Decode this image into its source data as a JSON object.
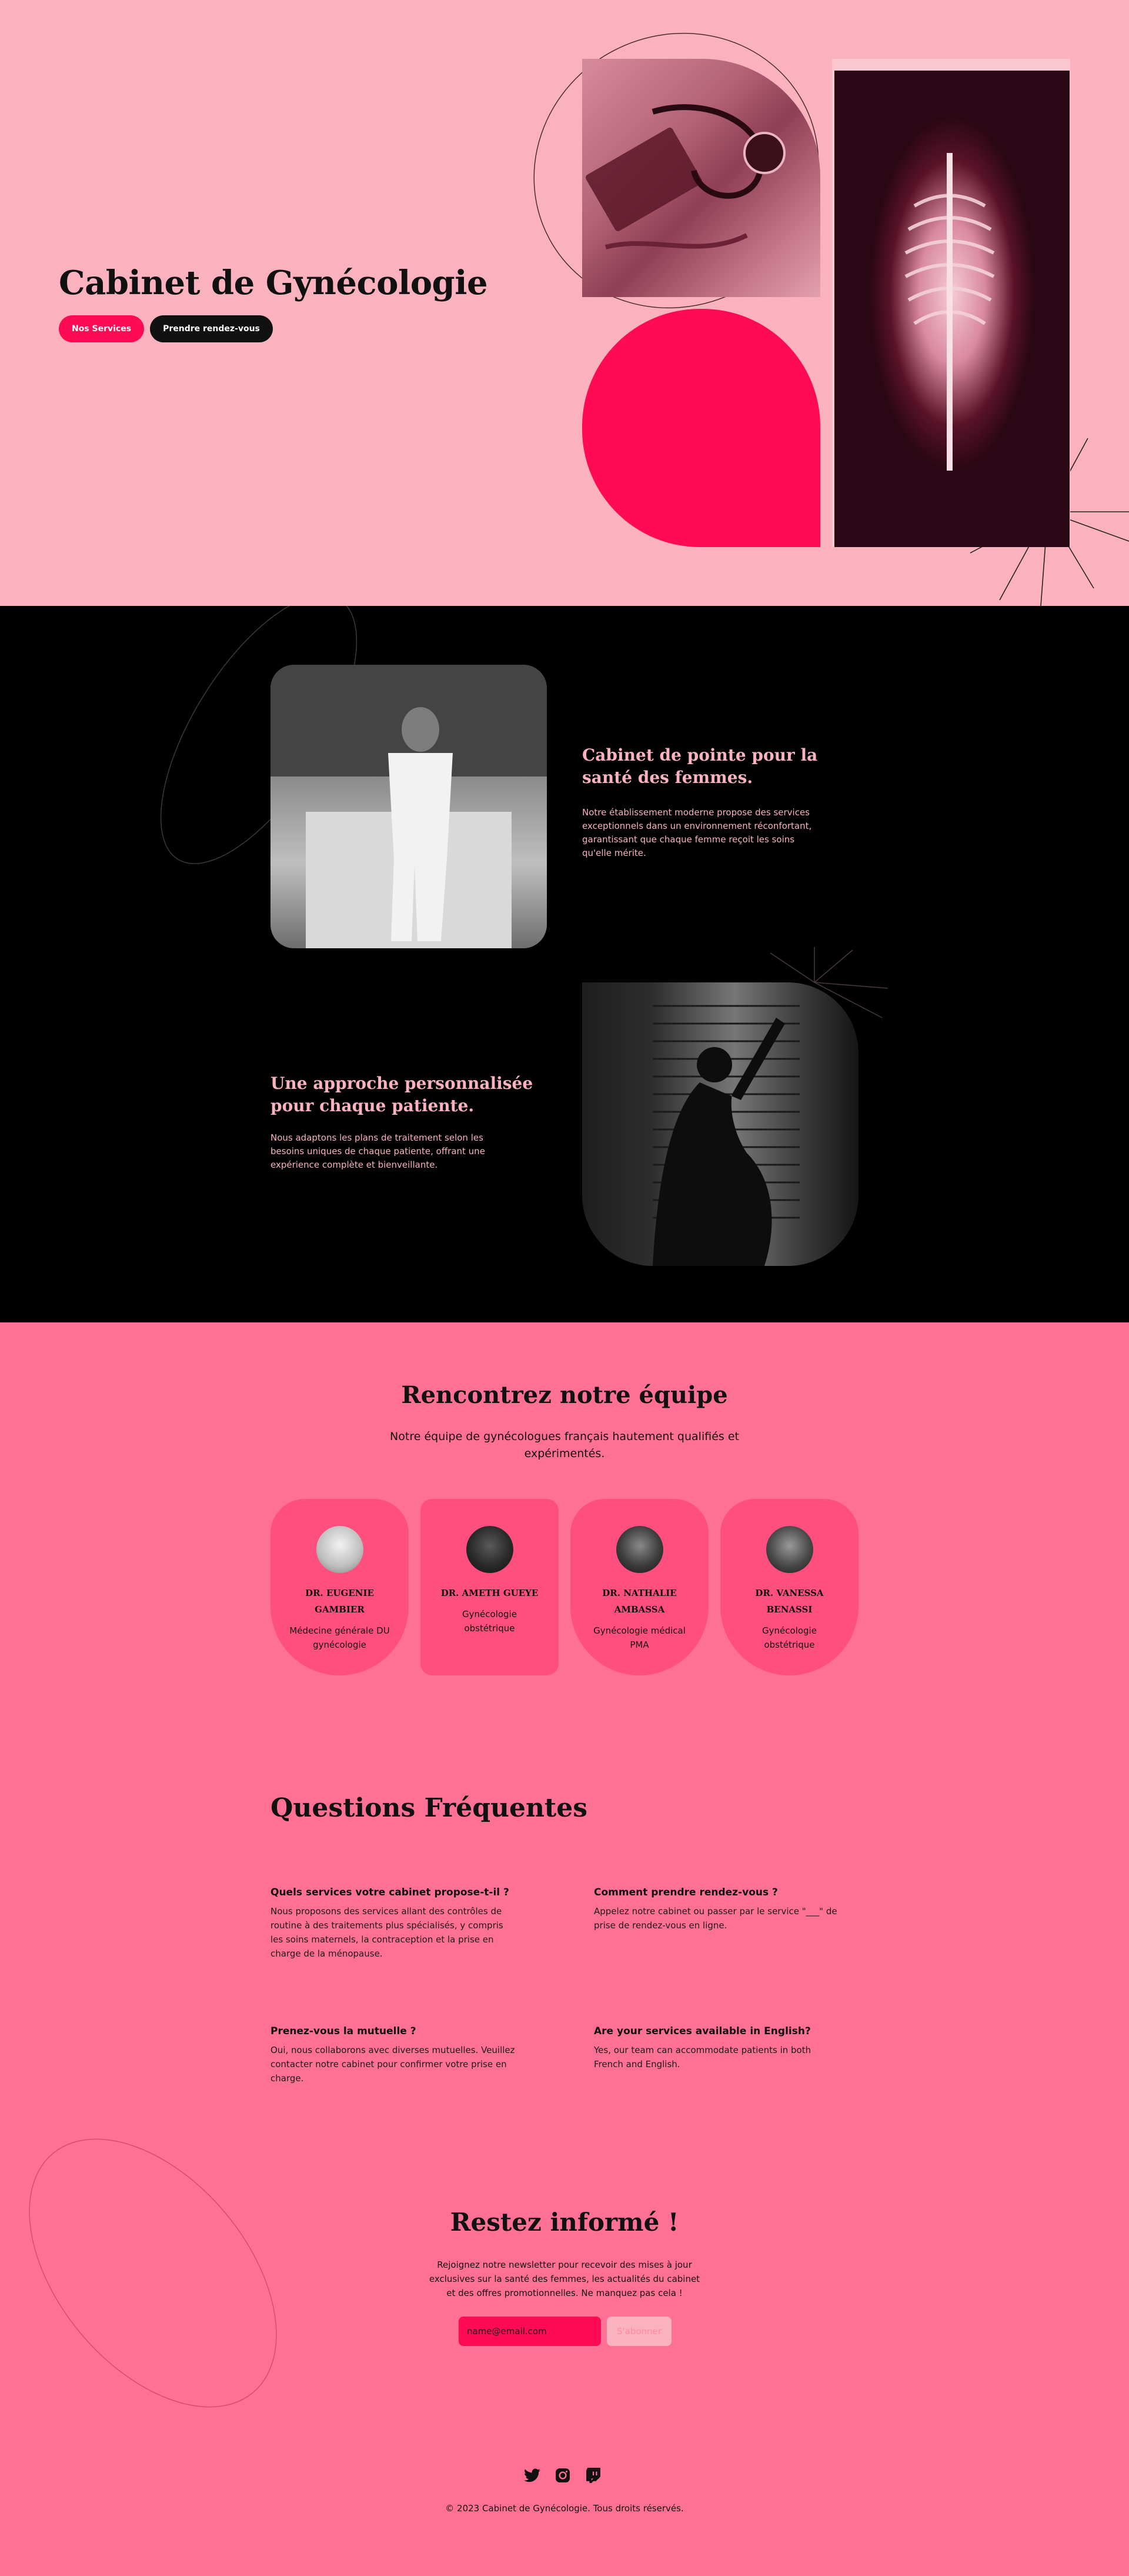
{
  "hero": {
    "title": "Cabinet de Gynécologie",
    "btn_services": "Nos Services",
    "btn_appointment": "Prendre rendez-vous"
  },
  "about": {
    "feature1": {
      "title": "Cabinet de pointe pour la santé des femmes.",
      "text": "Notre établissement moderne propose des services exceptionnels dans un environnement réconfortant, garantissant que chaque femme reçoit les soins qu'elle mérite."
    },
    "feature2": {
      "title": "Une approche personnalisée pour chaque patiente.",
      "text": "Nous adaptons les plans de traitement selon les besoins uniques de chaque patiente, offrant une expérience complète et bienveillante."
    }
  },
  "team": {
    "title": "Rencontrez notre équipe",
    "subtitle": "Notre équipe de gynécologues français hautement qualifiés et expérimentés.",
    "members": [
      {
        "name": "DR. EUGENIE GAMBIER",
        "role": "Médecine générale DU gynécologie"
      },
      {
        "name": "DR. AMETH GUEYE",
        "role": "Gynécologie obstétrique"
      },
      {
        "name": "DR. NATHALIE AMBASSA",
        "role": "Gynécologie médical PMA"
      },
      {
        "name": "DR. VANESSA BENASSI",
        "role": "Gynécologie obstétrique"
      }
    ]
  },
  "faq": {
    "title": "Questions Fréquentes",
    "items": [
      {
        "q": "Quels services votre cabinet propose-t-il ?",
        "a": "Nous proposons des services allant des contrôles de routine à des traitements plus spécialisés, y compris les soins maternels, la contraception et la prise en charge de la ménopause."
      },
      {
        "q": "Comment prendre rendez-vous ?",
        "a": "Appelez notre cabinet ou passer par le service \"___\" de prise de rendez-vous en ligne."
      },
      {
        "q": "Prenez-vous la mutuelle ?",
        "a": "Oui, nous collaborons avec diverses mutuelles. Veuillez contacter notre cabinet pour confirmer votre prise en charge."
      },
      {
        "q": "Are your services available in English?",
        "a": "Yes, our team can accommodate patients in both French and English."
      }
    ]
  },
  "newsletter": {
    "title": "Restez informé !",
    "text": "Rejoignez notre newsletter pour recevoir des mises à jour exclusives sur la santé des femmes, les actualités du cabinet et des offres promotionnelles. Ne manquez pas cela !",
    "placeholder": "name@email.com",
    "button": "S'abonner"
  },
  "footer": {
    "icons": [
      "twitter-icon",
      "instagram-icon",
      "twitch-icon"
    ],
    "copyright": "© 2023 Cabinet de  Gynécologie. Tous droits réservés."
  },
  "colors": {
    "hero_bg": "#fab3be",
    "accent": "#ff0a54",
    "section_dark": "#000000",
    "pink_bg": "#ff7095",
    "card_bg": "#ff4f7f"
  }
}
